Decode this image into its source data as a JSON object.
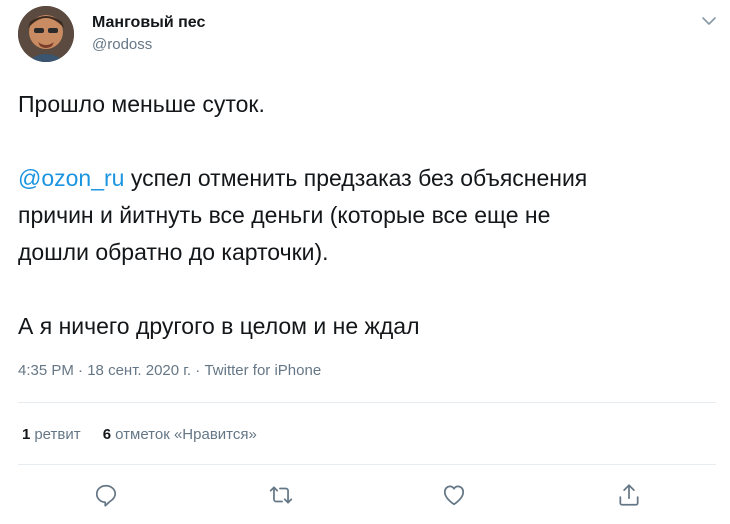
{
  "user": {
    "display_name": "Манговый пес",
    "handle": "@rodoss"
  },
  "tweet": {
    "line1": "Прошло меньше суток.",
    "mention": "@ozon_ru",
    "line2_after_mention": " успел отменить предзаказ без объяснения",
    "line3": "причин и йитнуть все деньги (которые все еще не",
    "line4": "дошли обратно до карточки).",
    "line5": "А я ничего другого в целом и не ждал"
  },
  "meta": {
    "time": "4:35 PM",
    "sep1": " · ",
    "date": "18 сент. 2020 г.",
    "sep2": " · ",
    "source": "Twitter for iPhone"
  },
  "stats": {
    "retweets_count": "1",
    "retweets_label": "ретвит",
    "likes_count": "6",
    "likes_label": "отметок «Нравится»"
  },
  "icons": {
    "reply": "reply-icon",
    "retweet": "retweet-icon",
    "like": "heart-icon",
    "share": "share-icon",
    "menu": "chevron-down-icon"
  },
  "colors": {
    "link": "#1b95e0",
    "secondary": "#657786",
    "divider": "#e6ecf0"
  }
}
